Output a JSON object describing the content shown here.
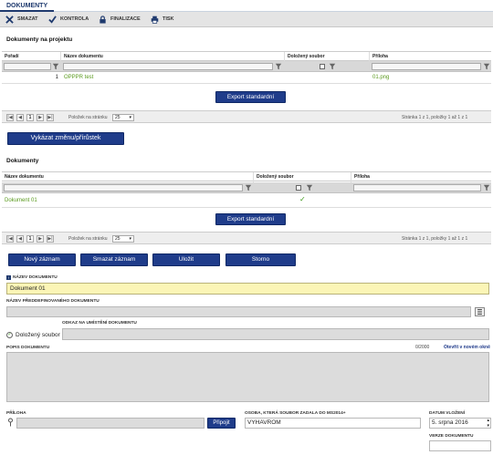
{
  "tab": {
    "label": "DOKUMENTY"
  },
  "toolbar": {
    "delete": "SMAZAT",
    "check": "KONTROLA",
    "finalize": "FINALIZACE",
    "print": "TISK"
  },
  "project_docs": {
    "title": "Dokumenty na projektu",
    "columns": [
      "Pořadí",
      "Název dokumentu",
      "Doložený soubor",
      "Příloha"
    ],
    "rows": [
      {
        "order": "1",
        "name": "OPPPR test",
        "file": "",
        "attachment": "01.png"
      }
    ],
    "export_label": "Export standardní",
    "pager": {
      "page": "1",
      "per_page_label": "Položek na stránku",
      "per_page": "25",
      "info": "Stránka 1 z 1, položky 1 až 1 z 1"
    }
  },
  "report_change_label": "Vykázat změnu/přírůstek",
  "docs": {
    "title": "Dokumenty",
    "columns": [
      "Název dokumentu",
      "Doložený soubor",
      "Příloha"
    ],
    "rows": [
      {
        "name": "Dokument 01",
        "file": "✓",
        "attachment": ""
      }
    ],
    "export_label": "Export standardní",
    "pager": {
      "page": "1",
      "per_page_label": "Položek na stránku",
      "per_page": "25",
      "info": "Stránka 1 z 1, položky 1 až 1 z 1"
    }
  },
  "actions": {
    "new": "Nový záznam",
    "delete": "Smazat záznam",
    "save": "Uložit",
    "cancel": "Storno"
  },
  "form": {
    "name_label": "NÁZEV DOKUMENTU",
    "name_value": "Dokument 01",
    "predefined_label": "NÁZEV PŘEDDEFINOVANÉHO DOKUMENTU",
    "predefined_value": "",
    "attached_label": "Doložený soubor",
    "location_label": "ODKAZ NA UMÍSTĚNÍ DOKUMENTU",
    "location_value": "",
    "desc_label": "POPIS DOKUMENTU",
    "desc_counter": "0/2000",
    "desc_open_link": "Otevřít v novém okně",
    "desc_value": "",
    "attachment_label": "PŘÍLOHA",
    "attach_button": "Připojit",
    "person_label": "OSOBA, KTERÁ SOUBOR ZADALA DO MS2014+",
    "person_value": "VYHAVROM",
    "date_label": "DATUM VLOŽENÍ",
    "date_value": "5. srpna 2016",
    "version_label": "VERZE DOKUMENTU",
    "version_value": ""
  }
}
